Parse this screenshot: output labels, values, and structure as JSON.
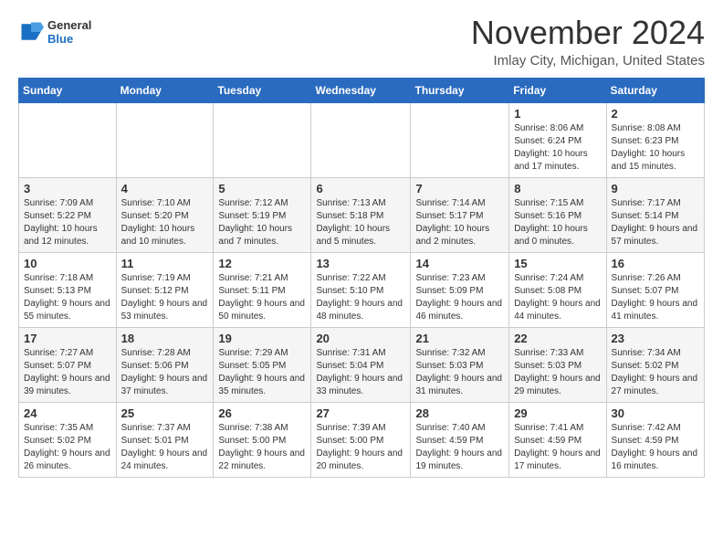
{
  "header": {
    "logo_general": "General",
    "logo_blue": "Blue",
    "month_title": "November 2024",
    "location": "Imlay City, Michigan, United States"
  },
  "weekdays": [
    "Sunday",
    "Monday",
    "Tuesday",
    "Wednesday",
    "Thursday",
    "Friday",
    "Saturday"
  ],
  "weeks": [
    [
      {
        "day": "",
        "info": ""
      },
      {
        "day": "",
        "info": ""
      },
      {
        "day": "",
        "info": ""
      },
      {
        "day": "",
        "info": ""
      },
      {
        "day": "",
        "info": ""
      },
      {
        "day": "1",
        "info": "Sunrise: 8:06 AM\nSunset: 6:24 PM\nDaylight: 10 hours and 17 minutes."
      },
      {
        "day": "2",
        "info": "Sunrise: 8:08 AM\nSunset: 6:23 PM\nDaylight: 10 hours and 15 minutes."
      }
    ],
    [
      {
        "day": "3",
        "info": "Sunrise: 7:09 AM\nSunset: 5:22 PM\nDaylight: 10 hours and 12 minutes."
      },
      {
        "day": "4",
        "info": "Sunrise: 7:10 AM\nSunset: 5:20 PM\nDaylight: 10 hours and 10 minutes."
      },
      {
        "day": "5",
        "info": "Sunrise: 7:12 AM\nSunset: 5:19 PM\nDaylight: 10 hours and 7 minutes."
      },
      {
        "day": "6",
        "info": "Sunrise: 7:13 AM\nSunset: 5:18 PM\nDaylight: 10 hours and 5 minutes."
      },
      {
        "day": "7",
        "info": "Sunrise: 7:14 AM\nSunset: 5:17 PM\nDaylight: 10 hours and 2 minutes."
      },
      {
        "day": "8",
        "info": "Sunrise: 7:15 AM\nSunset: 5:16 PM\nDaylight: 10 hours and 0 minutes."
      },
      {
        "day": "9",
        "info": "Sunrise: 7:17 AM\nSunset: 5:14 PM\nDaylight: 9 hours and 57 minutes."
      }
    ],
    [
      {
        "day": "10",
        "info": "Sunrise: 7:18 AM\nSunset: 5:13 PM\nDaylight: 9 hours and 55 minutes."
      },
      {
        "day": "11",
        "info": "Sunrise: 7:19 AM\nSunset: 5:12 PM\nDaylight: 9 hours and 53 minutes."
      },
      {
        "day": "12",
        "info": "Sunrise: 7:21 AM\nSunset: 5:11 PM\nDaylight: 9 hours and 50 minutes."
      },
      {
        "day": "13",
        "info": "Sunrise: 7:22 AM\nSunset: 5:10 PM\nDaylight: 9 hours and 48 minutes."
      },
      {
        "day": "14",
        "info": "Sunrise: 7:23 AM\nSunset: 5:09 PM\nDaylight: 9 hours and 46 minutes."
      },
      {
        "day": "15",
        "info": "Sunrise: 7:24 AM\nSunset: 5:08 PM\nDaylight: 9 hours and 44 minutes."
      },
      {
        "day": "16",
        "info": "Sunrise: 7:26 AM\nSunset: 5:07 PM\nDaylight: 9 hours and 41 minutes."
      }
    ],
    [
      {
        "day": "17",
        "info": "Sunrise: 7:27 AM\nSunset: 5:07 PM\nDaylight: 9 hours and 39 minutes."
      },
      {
        "day": "18",
        "info": "Sunrise: 7:28 AM\nSunset: 5:06 PM\nDaylight: 9 hours and 37 minutes."
      },
      {
        "day": "19",
        "info": "Sunrise: 7:29 AM\nSunset: 5:05 PM\nDaylight: 9 hours and 35 minutes."
      },
      {
        "day": "20",
        "info": "Sunrise: 7:31 AM\nSunset: 5:04 PM\nDaylight: 9 hours and 33 minutes."
      },
      {
        "day": "21",
        "info": "Sunrise: 7:32 AM\nSunset: 5:03 PM\nDaylight: 9 hours and 31 minutes."
      },
      {
        "day": "22",
        "info": "Sunrise: 7:33 AM\nSunset: 5:03 PM\nDaylight: 9 hours and 29 minutes."
      },
      {
        "day": "23",
        "info": "Sunrise: 7:34 AM\nSunset: 5:02 PM\nDaylight: 9 hours and 27 minutes."
      }
    ],
    [
      {
        "day": "24",
        "info": "Sunrise: 7:35 AM\nSunset: 5:02 PM\nDaylight: 9 hours and 26 minutes."
      },
      {
        "day": "25",
        "info": "Sunrise: 7:37 AM\nSunset: 5:01 PM\nDaylight: 9 hours and 24 minutes."
      },
      {
        "day": "26",
        "info": "Sunrise: 7:38 AM\nSunset: 5:00 PM\nDaylight: 9 hours and 22 minutes."
      },
      {
        "day": "27",
        "info": "Sunrise: 7:39 AM\nSunset: 5:00 PM\nDaylight: 9 hours and 20 minutes."
      },
      {
        "day": "28",
        "info": "Sunrise: 7:40 AM\nSunset: 4:59 PM\nDaylight: 9 hours and 19 minutes."
      },
      {
        "day": "29",
        "info": "Sunrise: 7:41 AM\nSunset: 4:59 PM\nDaylight: 9 hours and 17 minutes."
      },
      {
        "day": "30",
        "info": "Sunrise: 7:42 AM\nSunset: 4:59 PM\nDaylight: 9 hours and 16 minutes."
      }
    ]
  ]
}
